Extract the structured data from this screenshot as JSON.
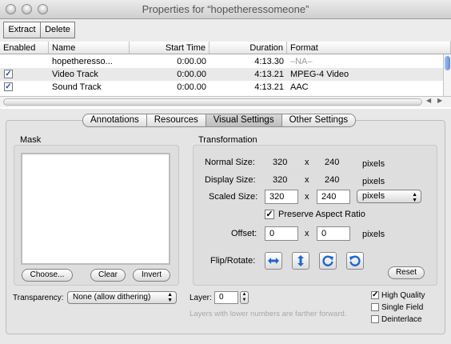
{
  "window": {
    "title": "Properties for “hopetheressomeone”"
  },
  "toolbar": {
    "extract": "Extract",
    "delete": "Delete"
  },
  "table": {
    "headers": {
      "enabled": "Enabled",
      "name": "Name",
      "start_time": "Start Time",
      "duration": "Duration",
      "format": "Format"
    },
    "rows": [
      {
        "enabled": null,
        "name": "hopetheresso...",
        "start_time": "0:00.00",
        "duration": "4:13.30",
        "format": "–NA–"
      },
      {
        "enabled": true,
        "name": "Video Track",
        "start_time": "0:00.00",
        "duration": "4:13.21",
        "format": "MPEG-4 Video"
      },
      {
        "enabled": true,
        "name": "Sound Track",
        "start_time": "0:00.00",
        "duration": "4:13.21",
        "format": "AAC"
      }
    ]
  },
  "tabs": [
    "Annotations",
    "Resources",
    "Visual Settings",
    "Other Settings"
  ],
  "selected_tab": "Visual Settings",
  "mask": {
    "title": "Mask",
    "choose": "Choose...",
    "clear": "Clear",
    "invert": "Invert"
  },
  "transformation": {
    "title": "Transformation",
    "normal_label": "Normal Size:",
    "normal_w": "320",
    "normal_h": "240",
    "display_label": "Display Size:",
    "display_w": "320",
    "display_h": "240",
    "scaled_label": "Scaled Size:",
    "scaled_w": "320",
    "scaled_h": "240",
    "scaled_unit": "pixels",
    "times": "x",
    "pixels": "pixels",
    "preserve_label": "Preserve Aspect Ratio",
    "preserve_checked": true,
    "offset_label": "Offset:",
    "offset_x": "0",
    "offset_y": "0",
    "flip_label": "Flip/Rotate:",
    "flip_icons": [
      "flip-horizontal-icon",
      "flip-vertical-icon",
      "rotate-clockwise-icon",
      "rotate-counterclockwise-icon"
    ],
    "reset": "Reset"
  },
  "transparency": {
    "label": "Transparency:",
    "value": "None (allow dithering)"
  },
  "layer": {
    "label": "Layer:",
    "value": "0",
    "hint": "Layers with lower numbers are farther forward."
  },
  "options": [
    {
      "label": "High Quality",
      "checked": true
    },
    {
      "label": "Single Field",
      "checked": false
    },
    {
      "label": "Deinterlace",
      "checked": false
    }
  ]
}
